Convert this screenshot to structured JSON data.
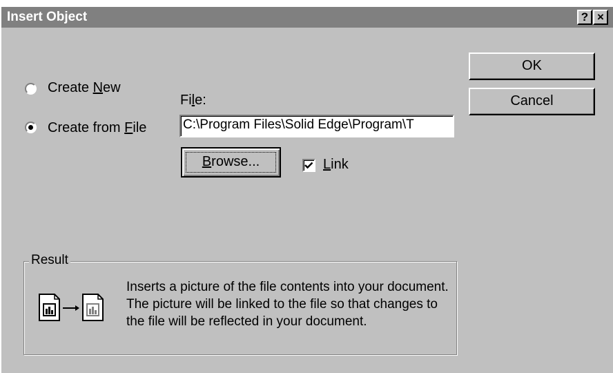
{
  "window": {
    "title": "Insert Object",
    "help_glyph": "?",
    "close_glyph": "×"
  },
  "options": {
    "create_new": {
      "label_pre": "Create ",
      "label_key": "N",
      "label_post": "ew",
      "selected": false
    },
    "create_from_file": {
      "label_pre": "Create from ",
      "label_key": "F",
      "label_post": "ile",
      "selected": true
    }
  },
  "file": {
    "label_pre": "Fi",
    "label_key": "l",
    "label_post": "e:",
    "value": "C:\\Program Files\\Solid Edge\\Program\\T"
  },
  "browse_button": {
    "label_key": "B",
    "label_post": "rowse..."
  },
  "link": {
    "label_key": "L",
    "label_post": "ink",
    "checked": true
  },
  "buttons": {
    "ok": "OK",
    "cancel": "Cancel"
  },
  "result": {
    "legend": "Result",
    "text": "Inserts a picture of the file contents into your document.  The picture will be linked to the file so that changes to the file will be reflected in your document.",
    "icon": "linked-picture-icon"
  },
  "colors": {
    "face": "#c0c0c0",
    "titlebar": "#808080",
    "shadow": "#808080",
    "highlight": "#ffffff"
  }
}
